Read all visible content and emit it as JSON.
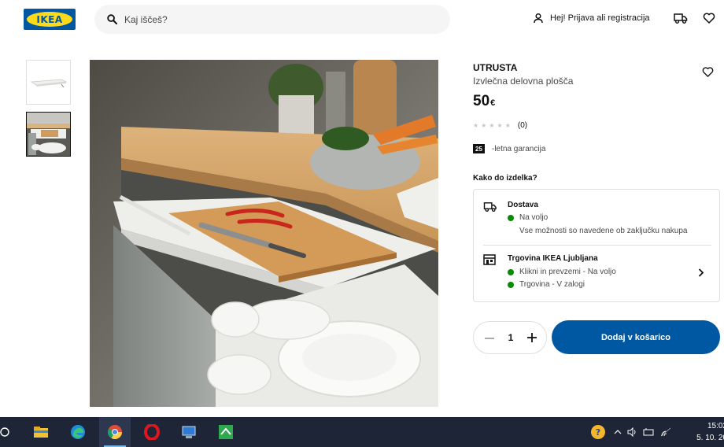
{
  "header": {
    "logo_text": "IKEA",
    "search_placeholder": "Kaj iščeš?",
    "account_label": "Hej! Prijava ali registracija",
    "icons": [
      "search-icon",
      "person-icon",
      "truck-icon",
      "heart-icon"
    ]
  },
  "gallery": {
    "thumbnails": [
      "thumbnail-product",
      "thumbnail-kitchen"
    ],
    "selected_index": 1
  },
  "product": {
    "name": "UTRUSTA",
    "description": "Izvlečna delovna plošča",
    "price": "50",
    "currency": "€",
    "stars": "★★★★★",
    "rating_count": "(0)",
    "warranty_years": "25",
    "warranty_text": "-letna garancija",
    "how_to_get": "Kako do izdelka?"
  },
  "availability": {
    "delivery": {
      "title": "Dostava",
      "status": "Na voljo",
      "note": "Vse možnosti so navedene ob zaključku nakupa"
    },
    "store": {
      "title": "Trgovina IKEA Ljubljana",
      "click_collect": "Klikni in prevzemi - Na voljo",
      "in_store": "Trgovina - V zalogi"
    },
    "status_color": "#0a8a00"
  },
  "cart": {
    "quantity": "1",
    "add_label": "Dodaj v košarico",
    "button_color": "#0058a3"
  },
  "taskbar": {
    "apps": [
      "search-icon",
      "file-explorer-icon",
      "edge-icon",
      "chrome-icon",
      "opera-icon",
      "remote-desktop-icon",
      "app-icon"
    ],
    "active_app": "chrome-icon",
    "time": "15:02",
    "date": "5. 10. 20"
  }
}
